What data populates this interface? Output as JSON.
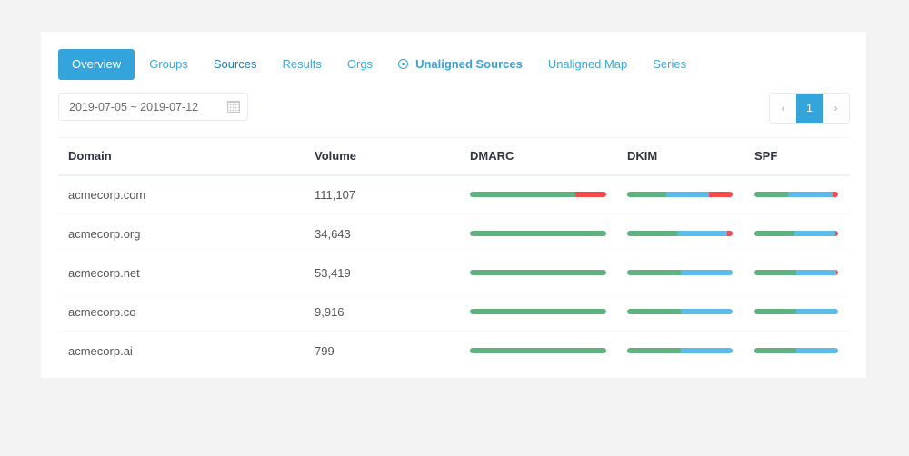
{
  "tabs": [
    {
      "label": "Overview",
      "active": true
    },
    {
      "label": "Groups"
    },
    {
      "label": "Sources"
    },
    {
      "label": "Results"
    },
    {
      "label": "Orgs"
    },
    {
      "label": "Unaligned Sources",
      "icon": "target-icon"
    },
    {
      "label": "Unaligned Map"
    },
    {
      "label": "Series"
    }
  ],
  "date_range": {
    "value": "2019-07-05 ~ 2019-07-12",
    "icon": "calendar-icon"
  },
  "pagination": {
    "prev": "‹",
    "current": "1",
    "next": "›"
  },
  "colors": {
    "pass": "#5fb27f",
    "aligned": "#5bbcec",
    "fail": "#f24b4b",
    "accent": "#33a5dc"
  },
  "table": {
    "headers": [
      "Domain",
      "Volume",
      "DMARC",
      "DKIM",
      "SPF"
    ],
    "rows": [
      {
        "domain": "acmecorp.com",
        "volume": "111,107",
        "dmarc": [
          77,
          0,
          23
        ],
        "dkim": [
          37,
          41,
          22
        ],
        "spf": [
          40,
          53,
          7
        ]
      },
      {
        "domain": "acmecorp.org",
        "volume": "34,643",
        "dmarc": [
          100,
          0,
          0
        ],
        "dkim": [
          47,
          48,
          5
        ],
        "spf": [
          48,
          49,
          3
        ]
      },
      {
        "domain": "acmecorp.net",
        "volume": "53,419",
        "dmarc": [
          100,
          0,
          0
        ],
        "dkim": [
          51,
          49,
          0
        ],
        "spf": [
          50,
          48,
          2
        ]
      },
      {
        "domain": "acmecorp.co",
        "volume": "9,916",
        "dmarc": [
          100,
          0,
          0
        ],
        "dkim": [
          51,
          49,
          0
        ],
        "spf": [
          50,
          50,
          0
        ]
      },
      {
        "domain": "acmecorp.ai",
        "volume": "799",
        "dmarc": [
          100,
          0,
          0
        ],
        "dkim": [
          51,
          49,
          0
        ],
        "spf": [
          50,
          50,
          0
        ]
      }
    ]
  }
}
